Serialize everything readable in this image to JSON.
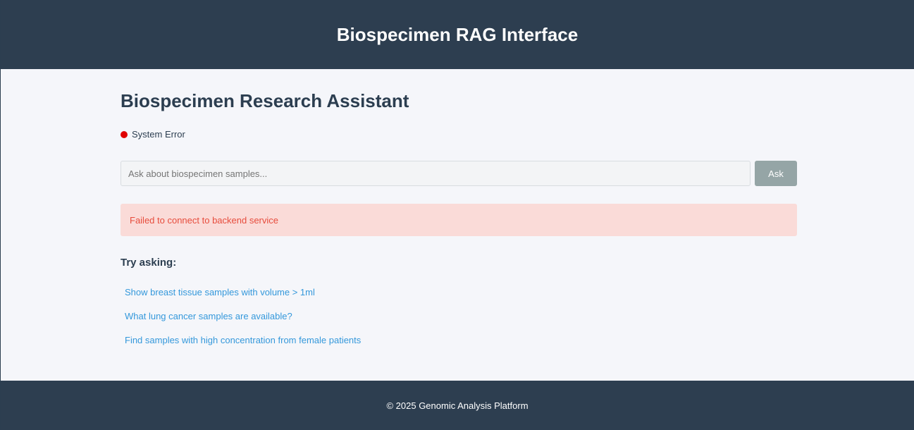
{
  "header": {
    "title": "Biospecimen RAG Interface"
  },
  "main": {
    "title": "Biospecimen Research Assistant",
    "status": {
      "label": "System Error",
      "color": "#e00000"
    },
    "query": {
      "placeholder": "Ask about biospecimen samples...",
      "value": "",
      "button_label": "Ask"
    },
    "error_message": "Failed to connect to backend service",
    "suggestions_heading": "Try asking:",
    "suggestions": [
      "Show breast tissue samples with volume > 1ml",
      "What lung cancer samples are available?",
      "Find samples with high concentration from female patients"
    ]
  },
  "footer": {
    "text": "© 2025 Genomic Analysis Platform"
  },
  "colors": {
    "header_bg": "#2d3e50",
    "page_bg": "#f5f6fa",
    "error_bg": "#fadbd8",
    "error_text": "#e74c3c",
    "link": "#3498db",
    "button_disabled": "#95a5a6"
  }
}
